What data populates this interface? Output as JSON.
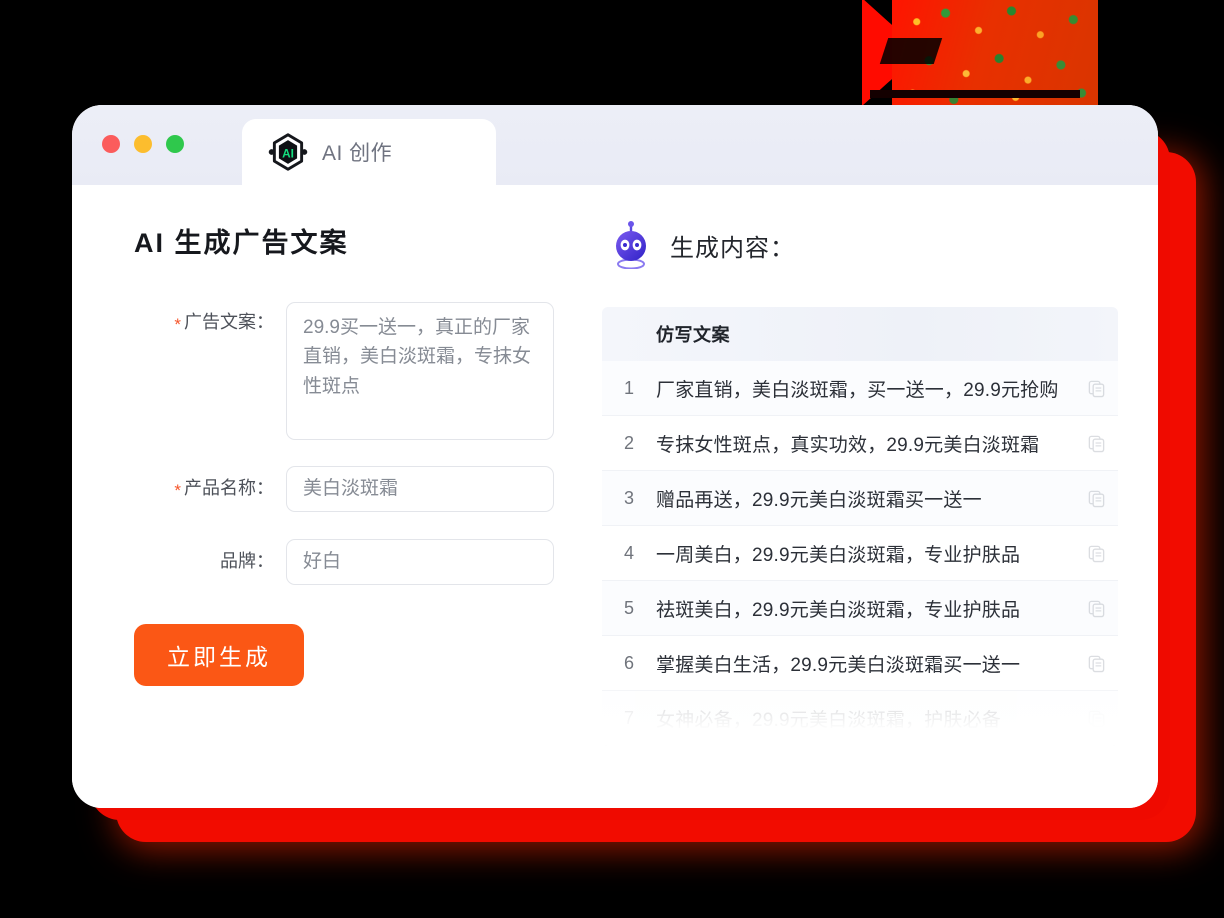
{
  "window": {
    "traffic_lights": [
      "close",
      "minimize",
      "maximize"
    ],
    "tab": {
      "label": "AI 创作",
      "logo_text": "AI",
      "logo_icon": "ai-hexagon-icon"
    }
  },
  "left_pane": {
    "title": "AI 生成广告文案",
    "fields": [
      {
        "label": "广告文案：",
        "required": true,
        "type": "textarea",
        "value": "29.9买一送一，真正的厂家直销，美白淡斑霜，专抹女性斑点",
        "placeholder": ""
      },
      {
        "label": "产品名称：",
        "required": true,
        "type": "input",
        "value": "美白淡斑霜",
        "placeholder": ""
      },
      {
        "label": "品牌：",
        "required": false,
        "type": "input",
        "value": "好白",
        "placeholder": ""
      }
    ],
    "generate_button": "立即生成"
  },
  "right_pane": {
    "icon": "robot-icon",
    "title": "生成内容：",
    "table": {
      "header": "仿写文案",
      "copy_icon": "copy-icon",
      "rows": [
        {
          "num": "1",
          "text": "厂家直销，美白淡斑霜，买一送一，29.9元抢购"
        },
        {
          "num": "2",
          "text": "专抹女性斑点，真实功效，29.9元美白淡斑霜"
        },
        {
          "num": "3",
          "text": "赠品再送，29.9元美白淡斑霜买一送一"
        },
        {
          "num": "4",
          "text": "一周美白，29.9元美白淡斑霜，专业护肤品"
        },
        {
          "num": "5",
          "text": "祛斑美白，29.9元美白淡斑霜，专业护肤品"
        },
        {
          "num": "6",
          "text": "掌握美白生活，29.9元美白淡斑霜买一送一"
        },
        {
          "num": "7",
          "text": "女神必备，29.9元美白淡斑霜，护肤必备"
        }
      ]
    }
  },
  "colors": {
    "accent_orange": "#fb5715",
    "required_star": "#f5552a",
    "titlebar_bg": "#eceef7",
    "logo_green": "#14e07f",
    "robot_purple": "#4b3fd4",
    "decor_red": "#ef0a00",
    "page_bg": "#000000"
  }
}
